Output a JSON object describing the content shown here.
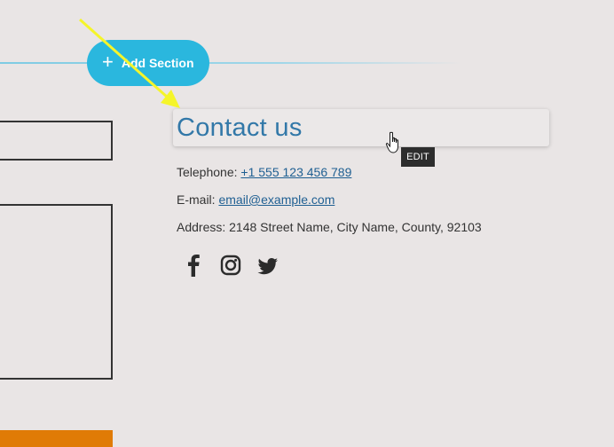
{
  "add_section": {
    "label": "Add Section",
    "icon": "plus-icon"
  },
  "contact": {
    "heading": "Contact us",
    "telephone_label": "Telephone:",
    "telephone_value": "+1 555 123 456 789",
    "email_label": "E-mail:",
    "email_value": "email@example.com",
    "address_label": "Address:",
    "address_value": "2148  Street Name, City Name, County, 92103"
  },
  "social_icons": [
    "facebook-icon",
    "instagram-icon",
    "twitter-icon"
  ],
  "tooltip": {
    "label": "EDIT"
  },
  "colors": {
    "background": "#e9e5e5",
    "accent": "#2ab7de",
    "heading": "#3278a8",
    "link": "#1f5f92",
    "orange": "#e07b06",
    "annotation_arrow": "#f5f52a"
  }
}
